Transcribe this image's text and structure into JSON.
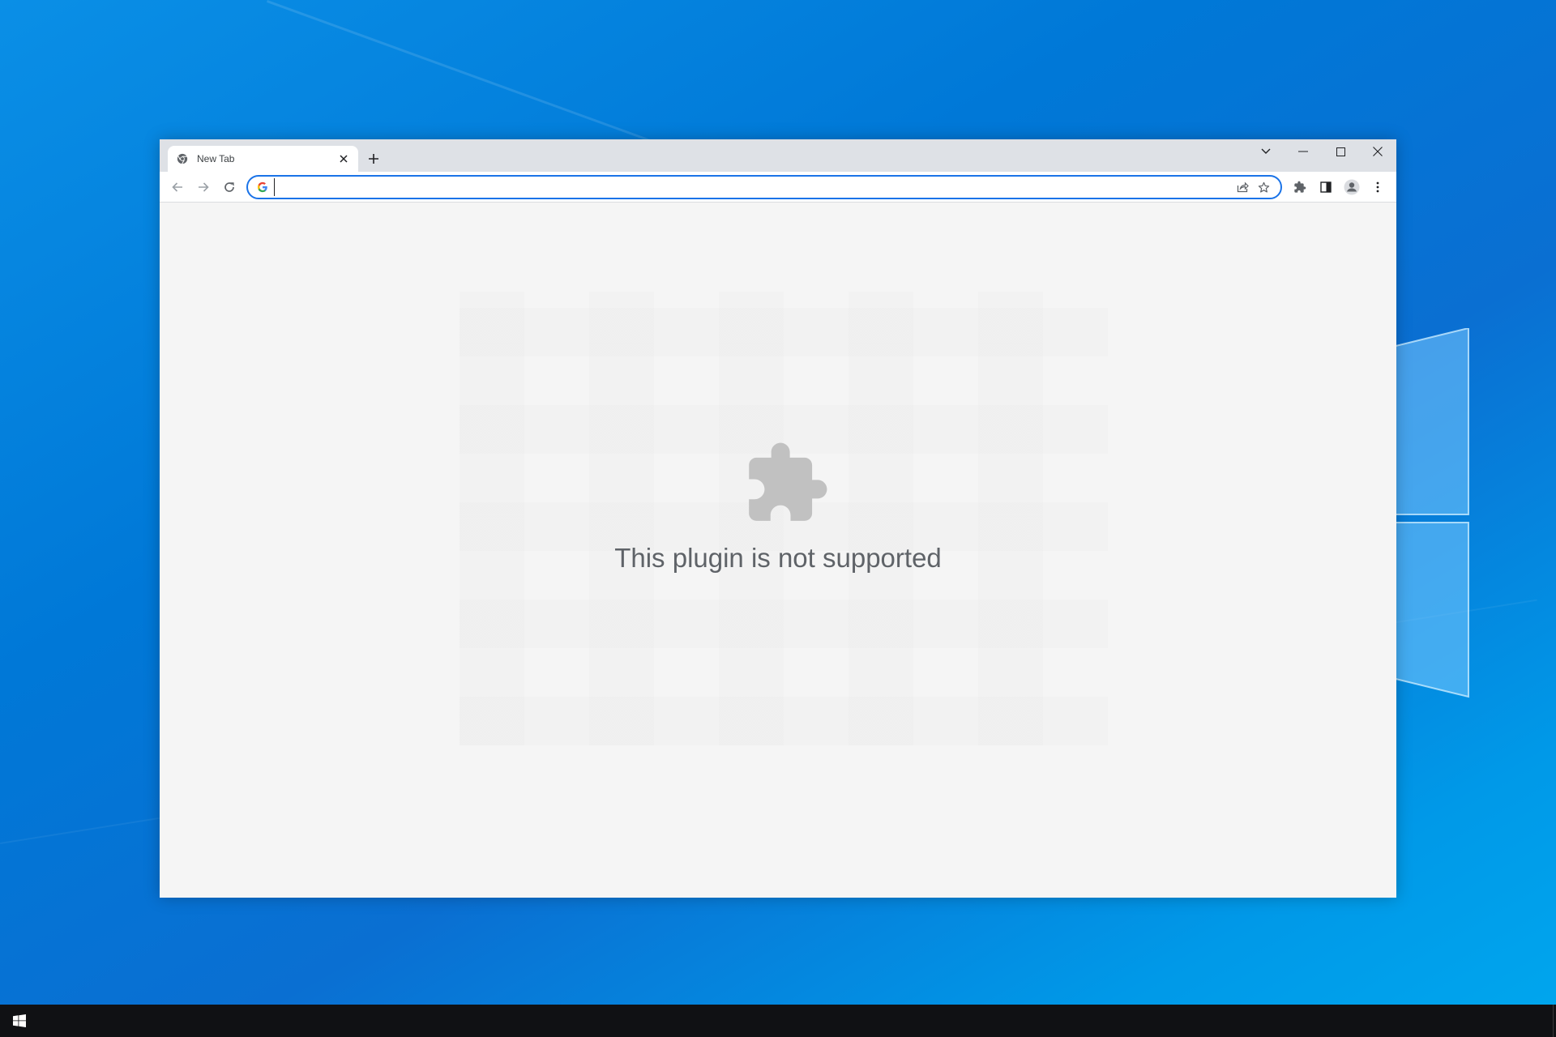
{
  "window": {
    "title": "New Tab"
  },
  "tabs": [
    {
      "label": "New Tab",
      "favicon": "chrome-icon",
      "active": true
    }
  ],
  "window_controls": [
    "chevron-down-icon",
    "minimize-icon",
    "maximize-icon",
    "close-icon"
  ],
  "toolbar": {
    "back_icon": "arrow-left-icon",
    "forward_icon": "arrow-right-icon",
    "reload_icon": "reload-icon"
  },
  "omnibox": {
    "value": "",
    "placeholder": "",
    "leading_icon": "google-g-icon",
    "trailing_icons": [
      "share-icon",
      "star-icon"
    ]
  },
  "toolbar_right": [
    "puzzle-icon",
    "side-panel-icon",
    "profile-icon",
    "more-vert-icon"
  ],
  "content": {
    "icon": "puzzle-icon",
    "message": "This plugin is not supported"
  },
  "taskbar": {
    "start_icon": "windows-icon"
  },
  "colors": {
    "accent": "#1a73e8",
    "tabstrip": "#dee1e6",
    "content_bg": "#f5f5f5",
    "message_text": "#5f6368",
    "plugin_icon": "#c1c1c1",
    "taskbar": "#101114"
  }
}
